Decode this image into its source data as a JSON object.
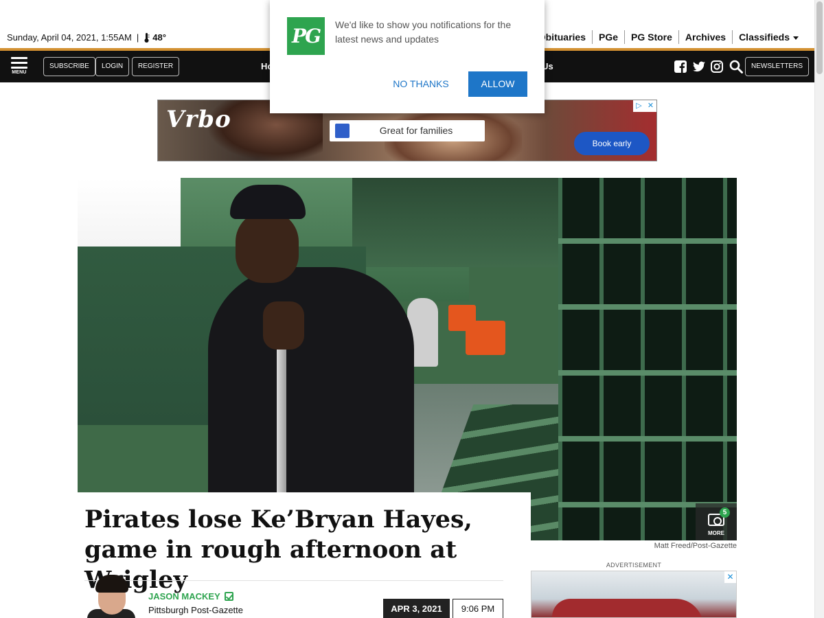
{
  "topbar": {
    "date": "Sunday, April 04, 2021, 1:55AM",
    "separator": "|",
    "temperature": "48°",
    "links": [
      "Obituaries",
      "PGe",
      "PG Store",
      "Archives",
      "Classifieds"
    ]
  },
  "nav": {
    "menu_label": "MENU",
    "buttons": [
      "SUBSCRIBE",
      "LOGIN",
      "REGISTER"
    ],
    "link_partial_left": "Ho",
    "link_partial_right": "ct Us",
    "newsletters": "NEWSLETTERS",
    "social_icons": [
      "facebook-icon",
      "twitter-icon",
      "instagram-icon",
      "search-icon"
    ]
  },
  "ad_banner": {
    "brand": "Vrbo",
    "pill_text": "Great for families",
    "cta": "Book early"
  },
  "photo": {
    "more_label": "MORE",
    "count": "5",
    "credit": "Matt Freed/Post-Gazette"
  },
  "article": {
    "headline": "Pirates lose Ke’Bryan Hayes, game in rough afternoon at Wrigley",
    "author": "JASON MACKEY",
    "organization": "Pittsburgh Post-Gazette",
    "date": "APR 3, 2021",
    "time": "9:06 PM"
  },
  "side_ad": {
    "label": "ADVERTISEMENT"
  },
  "popup": {
    "logo": "PG",
    "message": "We'd like to show you notifications for the latest news and updates",
    "decline": "NO THANKS",
    "accept": "ALLOW"
  },
  "colors": {
    "accent_orange": "#d39132",
    "brand_green": "#2ea44f",
    "button_blue": "#1e76c8",
    "nav_black": "#111111"
  }
}
